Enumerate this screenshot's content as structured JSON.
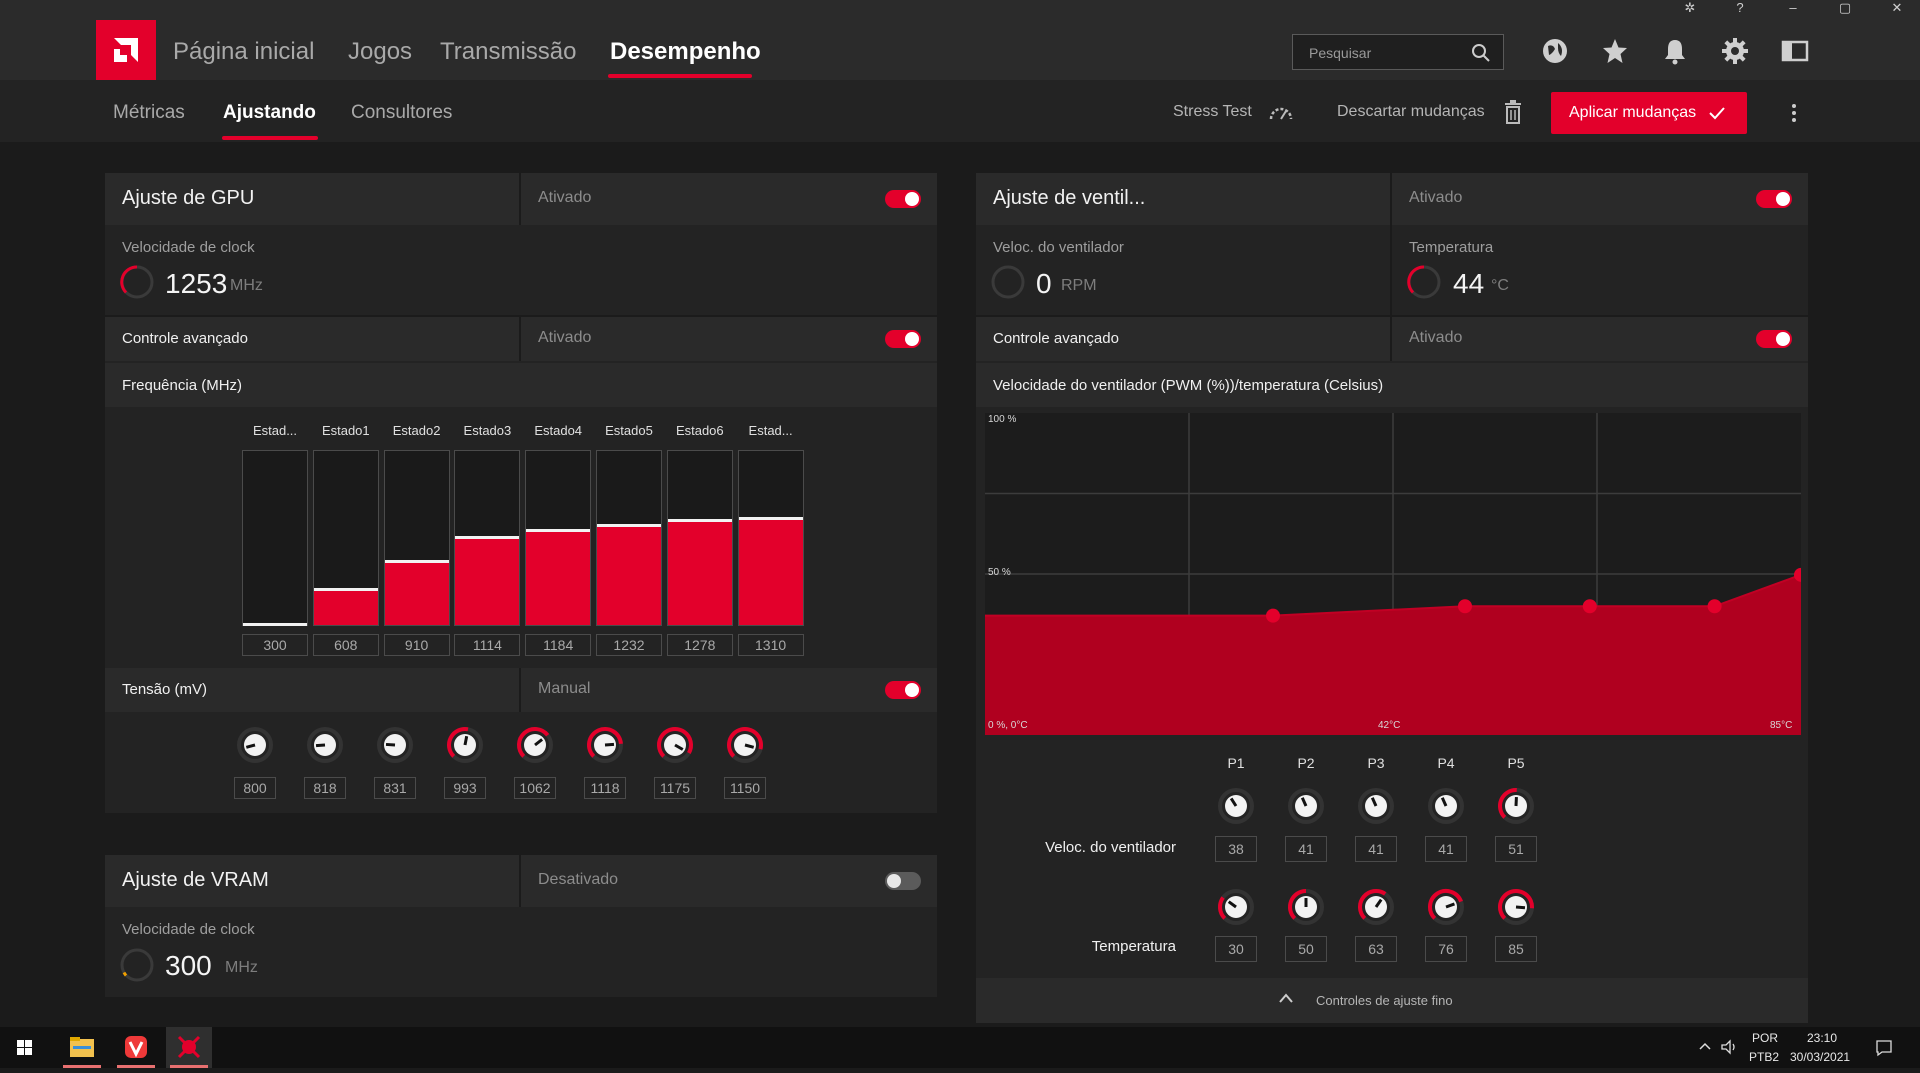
{
  "topnav": {
    "items": [
      "Página inicial",
      "Jogos",
      "Transmissão",
      "Desempenho"
    ],
    "active": "Desempenho",
    "search_placeholder": "Pesquisar"
  },
  "subnav": {
    "items": [
      "Métricas",
      "Ajustando",
      "Consultores"
    ],
    "active": "Ajustando",
    "stress_test": "Stress Test",
    "discard": "Descartar mudanças",
    "apply": "Aplicar mudanças"
  },
  "gpu": {
    "title": "Ajuste de GPU",
    "state": "Ativado",
    "clock_label": "Velocidade de clock",
    "clock_value": "1253",
    "clock_unit": "MHz",
    "advanced_label": "Controle avançado",
    "advanced_state": "Ativado",
    "freq_label": "Frequência (MHz)",
    "states": [
      "Estad...",
      "Estado1",
      "Estado2",
      "Estado3",
      "Estado4",
      "Estado5",
      "Estado6",
      "Estad..."
    ],
    "freq_values": [
      "300",
      "608",
      "910",
      "1114",
      "1184",
      "1232",
      "1278",
      "1310"
    ],
    "freq_fill": [
      0.0,
      0.2,
      0.36,
      0.5,
      0.54,
      0.57,
      0.6,
      0.61
    ],
    "voltage_label": "Tensão (mV)",
    "voltage_state": "Manual",
    "voltage_values": [
      "800",
      "818",
      "831",
      "993",
      "1062",
      "1118",
      "1175",
      "1150"
    ]
  },
  "vram": {
    "title": "Ajuste de VRAM",
    "state": "Desativado",
    "clock_label": "Velocidade de clock",
    "clock_value": "300",
    "clock_unit": "MHz"
  },
  "fan": {
    "title": "Ajuste de ventil...",
    "state": "Ativado",
    "speed_label": "Veloc. do ventilador",
    "speed_value": "0",
    "speed_unit": "RPM",
    "temp_label": "Temperatura",
    "temp_value": "44",
    "temp_unit": "°C",
    "advanced_label": "Controle avançado",
    "advanced_state": "Ativado",
    "chart_label": "Velocidade do ventilador (PWM (%))/temperatura (Celsius)",
    "axis": {
      "top": "100 %",
      "mid": "50 %",
      "origin": "0 %, 0°C",
      "xmid": "42°C",
      "xmax": "85°C"
    },
    "points": [
      "P1",
      "P2",
      "P3",
      "P4",
      "P5"
    ],
    "row_speed_label": "Veloc. do ventilador",
    "row_temp_label": "Temperatura",
    "speed_values": [
      "38",
      "41",
      "41",
      "41",
      "51"
    ],
    "temp_values": [
      "30",
      "50",
      "63",
      "76",
      "85"
    ],
    "fine_tune": "Controles de ajuste fino"
  },
  "chart_data": {
    "type": "area",
    "title": "",
    "xlabel": "",
    "ylabel": "",
    "xlim": [
      0,
      85
    ],
    "ylim": [
      0,
      100
    ],
    "series": [
      {
        "x": [
          0,
          30,
          50,
          63,
          76,
          85
        ],
        "values": [
          38,
          38,
          41,
          41,
          41,
          51
        ]
      }
    ]
  },
  "taskbar": {
    "lang": "POR",
    "layout": "PTB2",
    "time": "23:10",
    "date": "30/03/2021"
  },
  "colors": {
    "accent": "#e3002b",
    "chart_fill": "#b0001f"
  }
}
